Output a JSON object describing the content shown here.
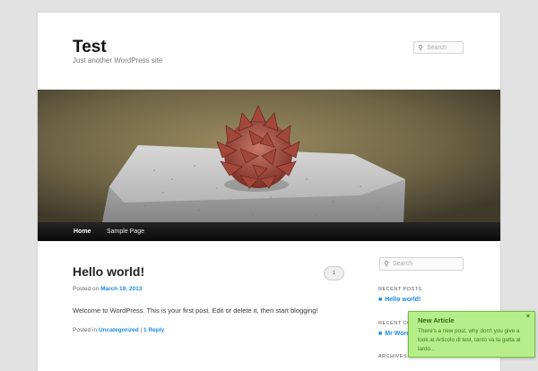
{
  "header": {
    "title": "Test",
    "tagline": "Just another WordPress site",
    "search_placeholder": "Search"
  },
  "nav": {
    "items": [
      "Home",
      "Sample Page"
    ]
  },
  "post": {
    "title": "Hello world!",
    "comment_count": "1",
    "posted_on_label": "Posted on",
    "date": "March 19, 2013",
    "body": "Welcome to WordPress. This is your first post. Edit or delete it, then start blogging!",
    "posted_in_label": "Posted in",
    "category": "Uncategorized",
    "separator": "|",
    "reply": "1 Reply"
  },
  "sidebar": {
    "search_placeholder": "Search",
    "recent_posts_title": "RECENT POSTS",
    "recent_post": "Hello world!",
    "recent_comments_title": "RECENT CO",
    "recent_comment": "Mr WordPr",
    "archives_title": "ARCHIVES"
  },
  "toast": {
    "title": "New Article",
    "close": "×",
    "body": "There's a new post, why don't you give a look at Articolo di test, tanto va la gatta al lardo..."
  },
  "colors": {
    "link": "#1b8be0",
    "nav_bg": "#111111",
    "toast_bg": "#b6ee8a",
    "toast_text": "#2a6b11"
  }
}
